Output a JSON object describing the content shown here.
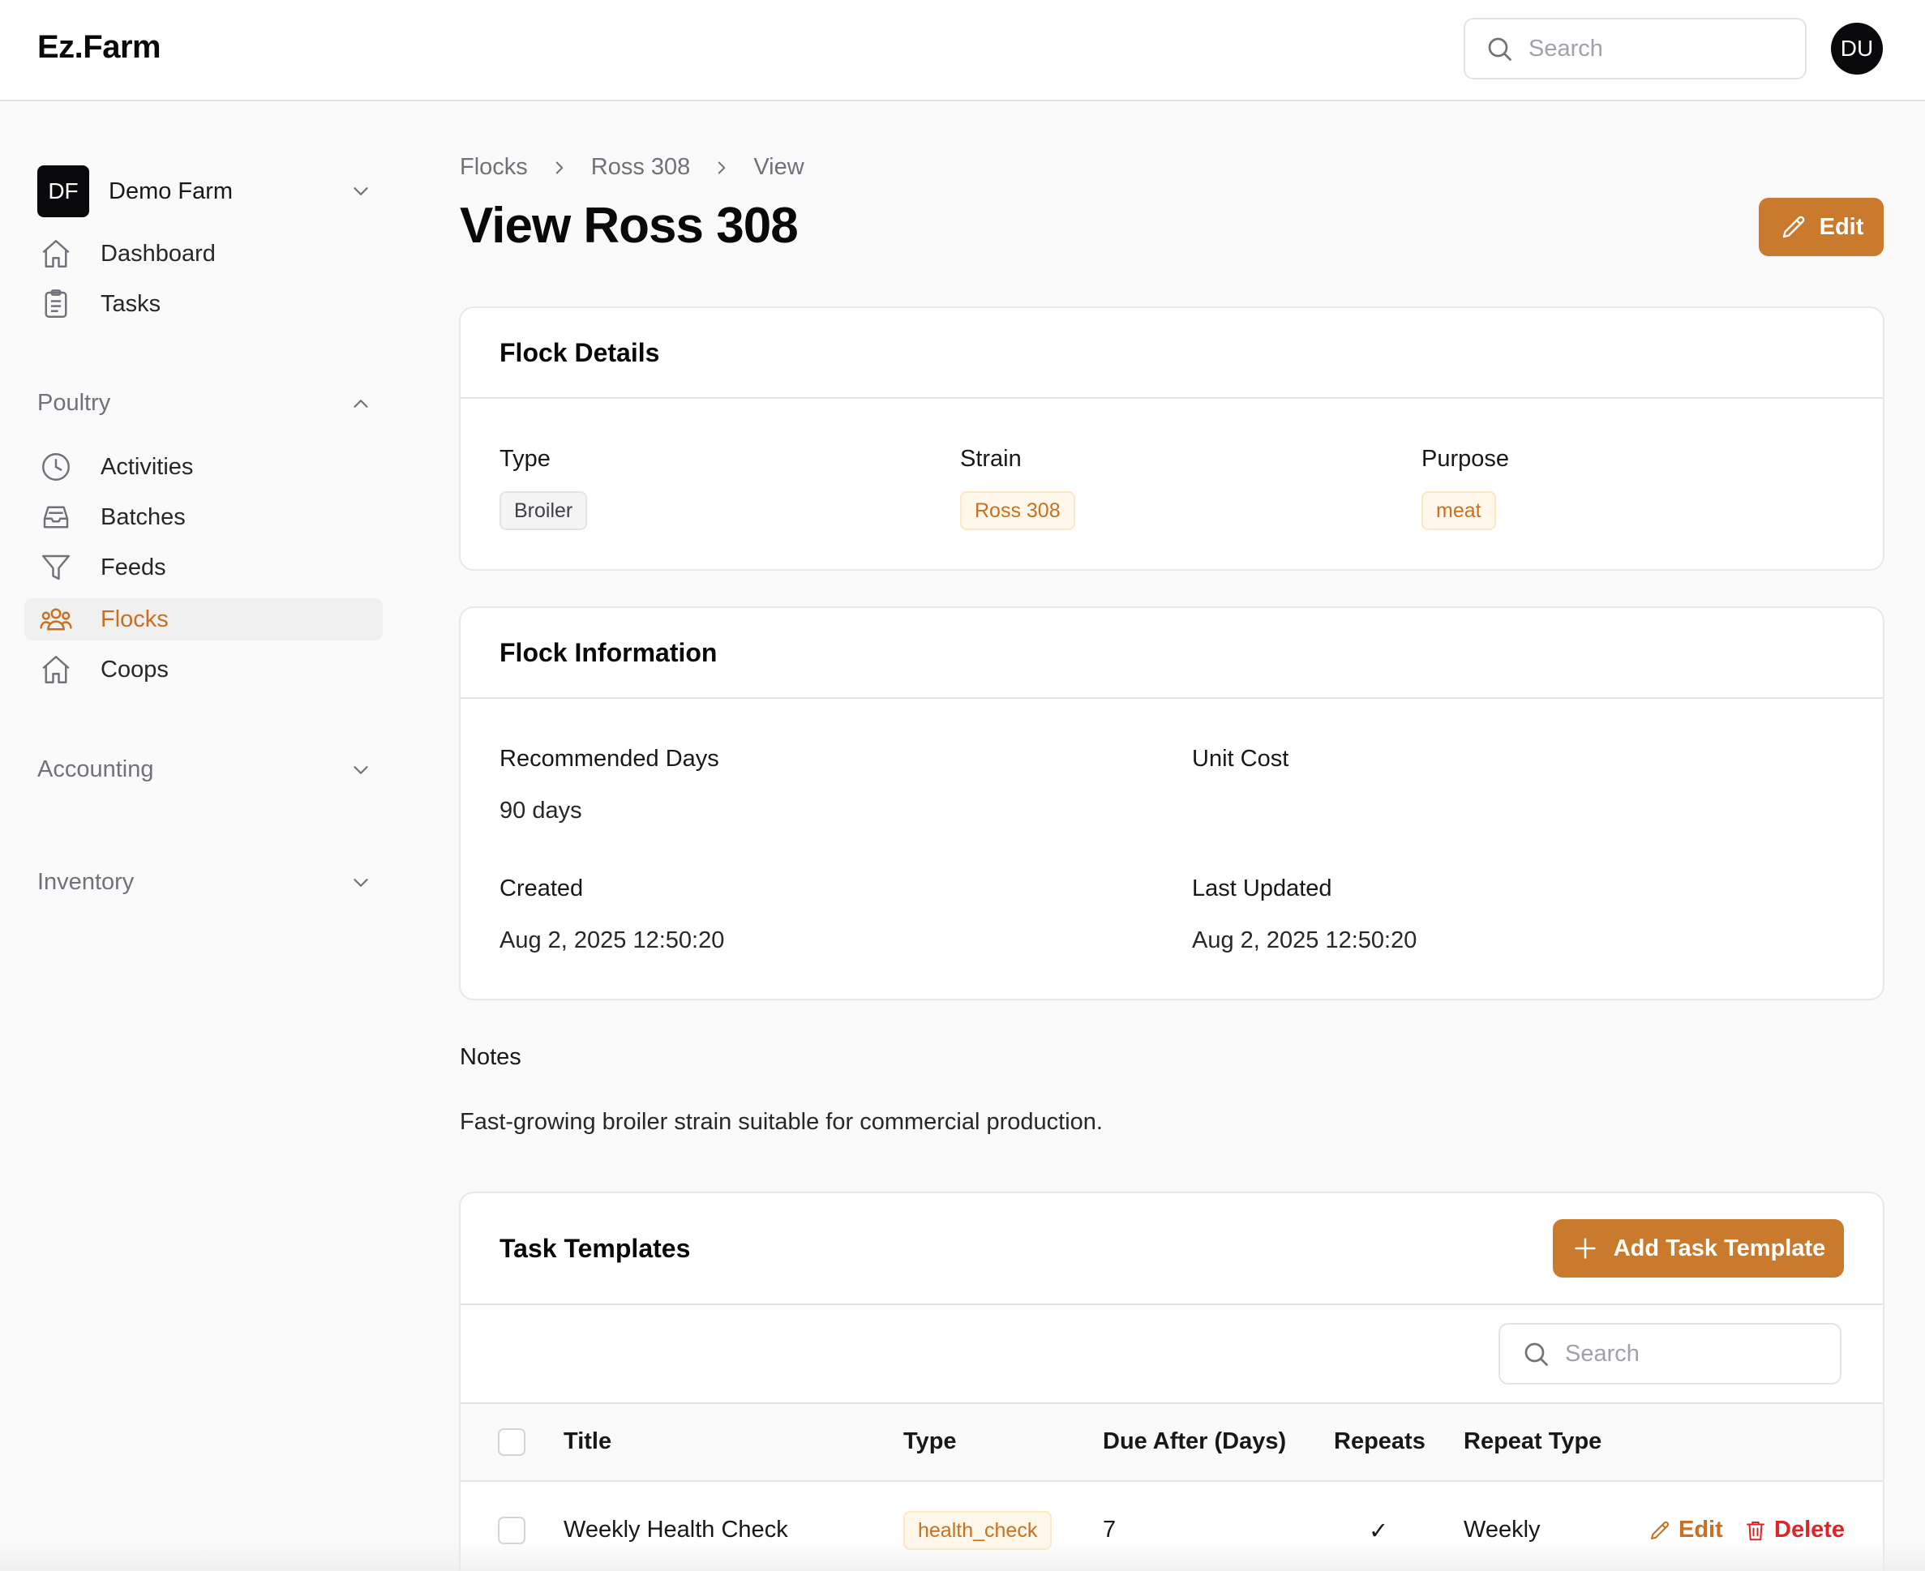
{
  "app": {
    "brand": "Ez.Farm"
  },
  "header": {
    "search_placeholder": "Search",
    "avatar_initials": "DU"
  },
  "sidebar": {
    "farm": {
      "initials": "DF",
      "name": "Demo Farm"
    },
    "top_items": [
      {
        "label": "Dashboard",
        "icon": "home-icon"
      },
      {
        "label": "Tasks",
        "icon": "clipboard-icon"
      }
    ],
    "poultry": {
      "title": "Poultry",
      "items": [
        {
          "label": "Activities",
          "icon": "clock-icon"
        },
        {
          "label": "Batches",
          "icon": "inbox-icon"
        },
        {
          "label": "Feeds",
          "icon": "funnel-icon"
        },
        {
          "label": "Flocks",
          "icon": "users-icon",
          "active": true
        },
        {
          "label": "Coops",
          "icon": "home-icon"
        }
      ]
    },
    "accounting": {
      "title": "Accounting"
    },
    "inventory": {
      "title": "Inventory"
    }
  },
  "breadcrumb": [
    "Flocks",
    "Ross 308",
    "View"
  ],
  "page": {
    "title": "View Ross 308",
    "edit_label": "Edit"
  },
  "flock_details": {
    "title": "Flock Details",
    "type_label": "Type",
    "type_value": "Broiler",
    "strain_label": "Strain",
    "strain_value": "Ross 308",
    "purpose_label": "Purpose",
    "purpose_value": "meat"
  },
  "flock_info": {
    "title": "Flock Information",
    "recommended_days_label": "Recommended Days",
    "recommended_days_value": "90 days",
    "unit_cost_label": "Unit Cost",
    "unit_cost_value": "",
    "created_label": "Created",
    "created_value": "Aug 2, 2025 12:50:20",
    "updated_label": "Last Updated",
    "updated_value": "Aug 2, 2025 12:50:20"
  },
  "notes": {
    "label": "Notes",
    "text": "Fast-growing broiler strain suitable for commercial production."
  },
  "task_templates": {
    "title": "Task Templates",
    "add_label": "Add Task Template",
    "search_placeholder": "Search",
    "columns": [
      "Title",
      "Type",
      "Due After (Days)",
      "Repeats",
      "Repeat Type"
    ],
    "rows": [
      {
        "title": "Weekly Health Check",
        "type": "health_check",
        "due_after": "7",
        "repeats": "✓",
        "repeat_type": "Weekly",
        "edit_label": "Edit",
        "delete_label": "Delete"
      }
    ]
  },
  "colors": {
    "accent": "#c97a2c",
    "accent_text": "#c96f21",
    "danger": "#dc2626"
  }
}
